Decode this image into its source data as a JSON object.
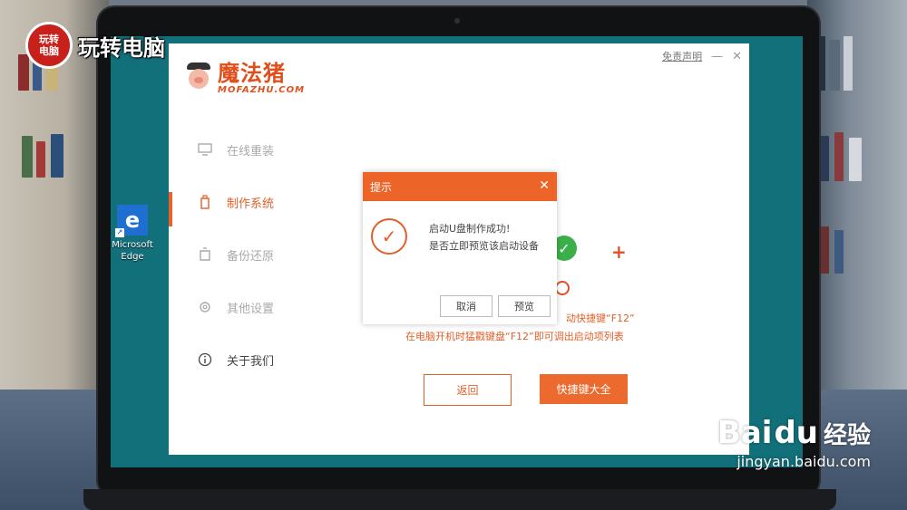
{
  "watermark": {
    "channel_badge_line1": "玩转",
    "channel_badge_line2": "电脑",
    "channel_title": "玩转电脑",
    "baidu_brand_left": "Bai",
    "baidu_brand_paw": "du",
    "baidu_brand_right": "经验",
    "baidu_url": "jingyan.baidu.com"
  },
  "desktop": {
    "icon_label_line1": "Microsoft",
    "icon_label_line2": "Edge",
    "icon_glyph": "e"
  },
  "app": {
    "logo_cn": "魔法猪",
    "logo_en": "MOFAZHU.COM",
    "disclaimer": "免责声明",
    "minimize": "—",
    "close": "✕",
    "nav": [
      {
        "label": "在线重装",
        "icon": "monitor-icon"
      },
      {
        "label": "制作系统",
        "icon": "usb-icon"
      },
      {
        "label": "备份还原",
        "icon": "backup-icon"
      },
      {
        "label": "其他设置",
        "icon": "gear-icon"
      },
      {
        "label": "关于我们",
        "icon": "info-icon"
      }
    ],
    "active_nav": "制作系统",
    "content": {
      "hint_line1": "动快捷键“F12”",
      "hint_line2": "在电脑开机时猛戳键盘“F12”即可调出启动项列表",
      "back_button": "返回",
      "hotkeys_button": "快捷键大全"
    }
  },
  "dialog": {
    "title": "提示",
    "close": "✕",
    "message_line1": "启动U盘制作成功!",
    "message_line2": "是否立即预览该启动设备",
    "cancel_button": "取消",
    "preview_button": "预览"
  },
  "colors": {
    "accent": "#ec6428",
    "desktop": "#11707a",
    "check_green": "#3bb04a"
  }
}
